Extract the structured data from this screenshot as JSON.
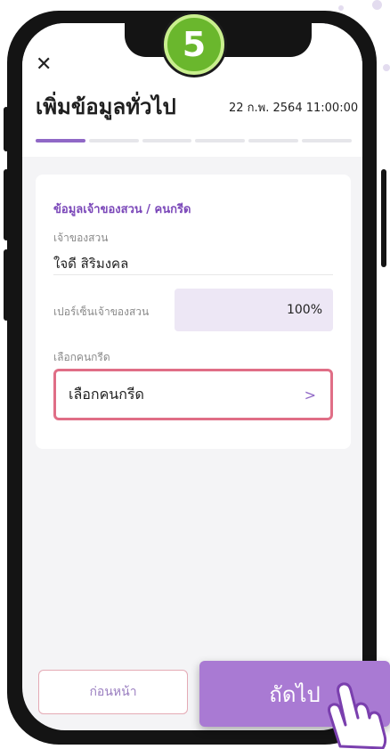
{
  "step_number": "5",
  "header": {
    "title": "เพิ่มข้อมูลทั่วไป",
    "datetime": "22 ก.พ. 2564  11:00:00",
    "progress": {
      "total_steps": 6,
      "current_step": 1
    }
  },
  "card": {
    "section_title": "ข้อมูลเจ้าของสวน / คนกรีด",
    "owner_label": "เจ้าของสวน",
    "owner_name": "ใจดี สิริมงคล",
    "percent_label": "เปอร์เซ็นเจ้าของสวน",
    "percent_value": "100%",
    "tapper_label": "เลือกคนกรีด",
    "tapper_value": "เลือกคนกรีด"
  },
  "buttons": {
    "back_label": "ก่อนหน้า",
    "next_label": "ถัดไป"
  },
  "colors": {
    "accent": "#9068c6",
    "highlight": "#e06e86",
    "step_badge": "#6ab72d",
    "next_button": "#a97ad3"
  }
}
